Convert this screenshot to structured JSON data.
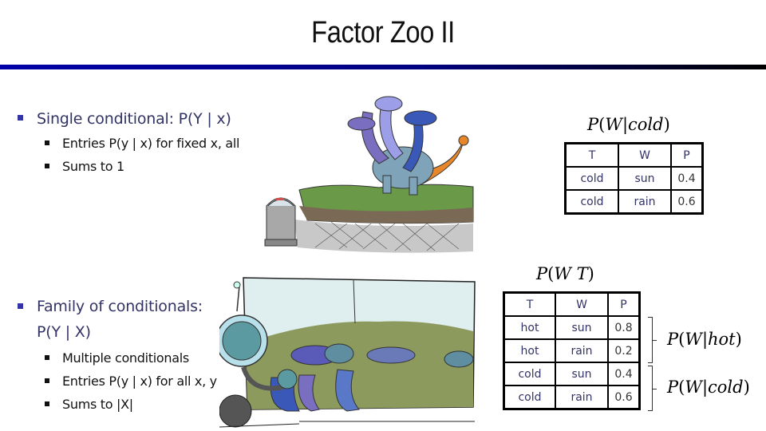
{
  "slide": {
    "title": "Factor Zoo II",
    "colors": {
      "title_rule_start": "#0000a8",
      "title_rule_end": "#000000",
      "main_bullet_text": "#333366",
      "main_bullet_marker": "#3434a8",
      "sub_bullet_text": "#111111",
      "table_text": "#333366"
    }
  },
  "section1": {
    "heading": "Single conditional: P(Y | x)",
    "sub_items": [
      "Entries P(y | x) for fixed x, all",
      "Sums to 1"
    ]
  },
  "section2": {
    "heading_line1": "Family of conditionals:",
    "heading_line2": "P(Y | X)",
    "sub_items": [
      "Multiple conditionals",
      "Entries P(y | x) for all x, y",
      "Sums to |X|"
    ]
  },
  "table_single": {
    "label": {
      "P": "P",
      "open": "(",
      "W": "W",
      "bar": "|",
      "given": "cold",
      "close": ")"
    },
    "headers": [
      "T",
      "W",
      "P"
    ],
    "rows": [
      [
        "cold",
        "sun",
        "0.4"
      ],
      [
        "cold",
        "rain",
        "0.6"
      ]
    ]
  },
  "table_family": {
    "label": {
      "P": "P",
      "open": "(",
      "W": "W",
      "bar": " ",
      "given": "T",
      "close": ")"
    },
    "headers": [
      "T",
      "W",
      "P"
    ],
    "rows": [
      [
        "hot",
        "sun",
        "0.8"
      ],
      [
        "hot",
        "rain",
        "0.2"
      ],
      [
        "cold",
        "sun",
        "0.4"
      ],
      [
        "cold",
        "rain",
        "0.6"
      ]
    ],
    "groups": [
      {
        "label": {
          "P": "P",
          "open": "(",
          "W": "W",
          "bar": "|",
          "given": "hot",
          "close": ")"
        }
      },
      {
        "label": {
          "P": "P",
          "open": "(",
          "W": "W",
          "bar": "|",
          "given": "cold",
          "close": ")"
        }
      }
    ]
  },
  "illustrations": {
    "top": "three-headed-dragon-on-grass-with-robot",
    "bottom": "robot-viewing-dragon-family-picture"
  }
}
